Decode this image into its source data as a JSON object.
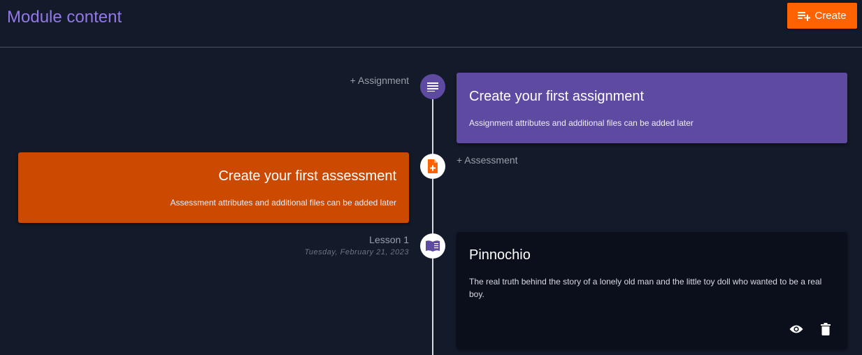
{
  "header": {
    "title": "Module content",
    "create_label": "Create"
  },
  "timeline": {
    "assignment": {
      "side_label": "+ Assignment",
      "card_title": "Create your first assignment",
      "card_desc": "Assignment attributes and additional files can be added later",
      "icon": "list-icon"
    },
    "assessment": {
      "side_label": "+ Assessment",
      "card_title": "Create your first assessment",
      "card_desc": "Assessment attributes and additional files can be added later",
      "icon": "file-plus-icon"
    },
    "lesson": {
      "side_label": "Lesson 1",
      "date": "Tuesday, February 21, 2023",
      "card_title": "Pinnochio",
      "card_desc": "The real truth behind the story of a lonely old man and the little toy doll who wanted to be a real boy.",
      "icon": "book-icon",
      "actions": [
        "eye-icon",
        "trash-icon"
      ]
    }
  },
  "colors": {
    "background": "#131a2a",
    "title": "#9278e8",
    "create_button": "#ff6200",
    "assignment": "#5f4aa2",
    "assessment": "#cc4a00",
    "lesson_card": "#0b0f1b"
  }
}
